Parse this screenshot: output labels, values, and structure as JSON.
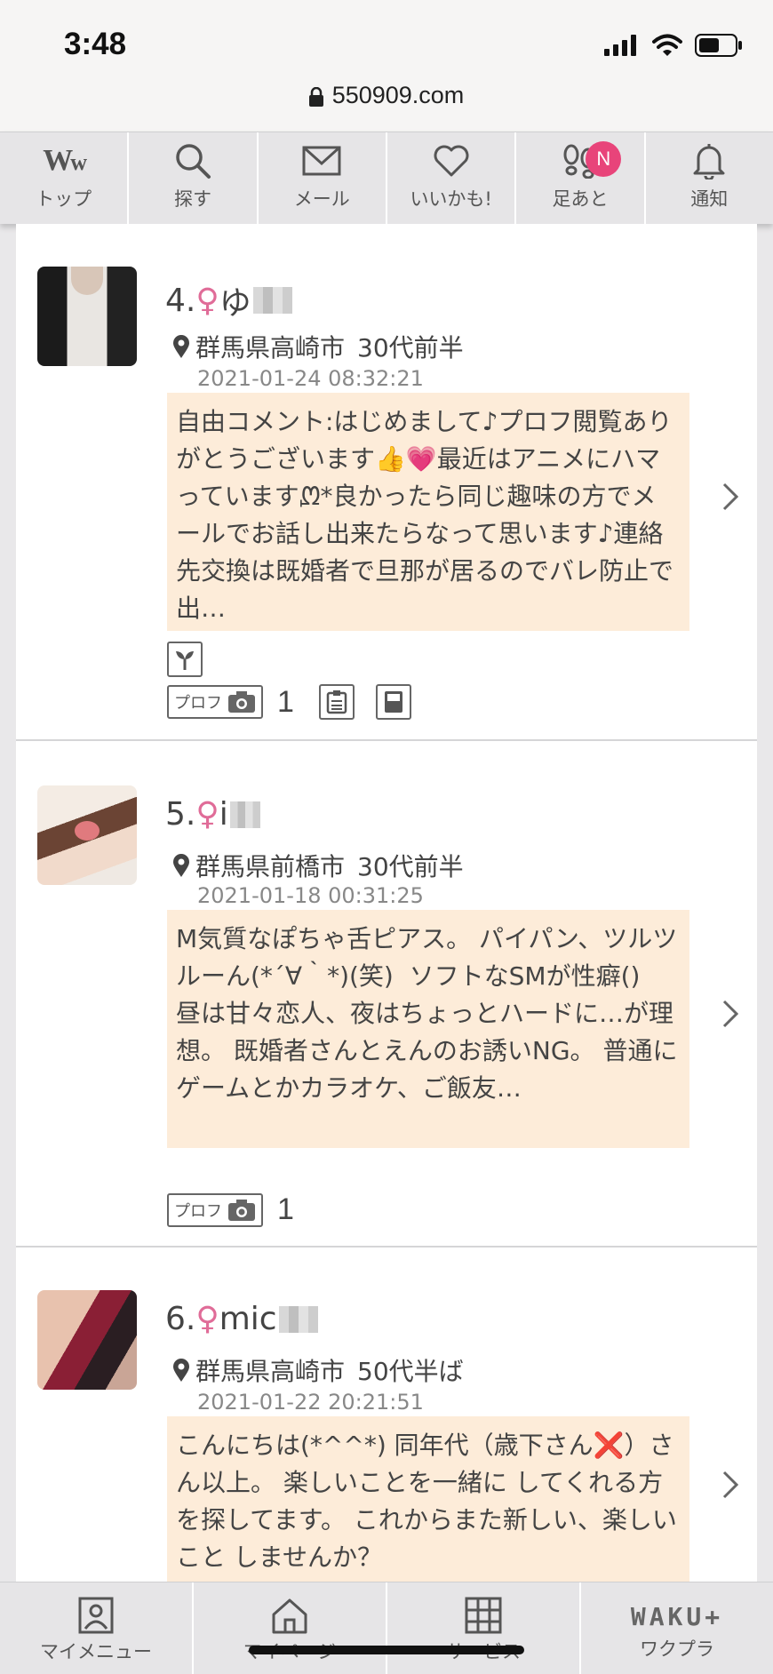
{
  "status_bar": {
    "time": "3:48",
    "url": "550909.com",
    "icons": [
      "cellular-signal-icon",
      "wifi-icon",
      "battery-icon",
      "lock-icon"
    ]
  },
  "top_nav": {
    "items": [
      {
        "label": "トップ",
        "icon": "ww-logo-icon"
      },
      {
        "label": "探す",
        "icon": "search-icon"
      },
      {
        "label": "メール",
        "icon": "mail-icon"
      },
      {
        "label": "いいかも!",
        "icon": "heart-icon"
      },
      {
        "label": "足あと",
        "icon": "footprints-icon",
        "badge": "N"
      },
      {
        "label": "通知",
        "icon": "bell-icon"
      }
    ],
    "badge_color": "#e8447a"
  },
  "profiles": [
    {
      "number": "4.",
      "gender_symbol": "♀",
      "name": "ゆ",
      "location": "群馬県高崎市",
      "age": "30代前半",
      "date": "2021-01-24 08:32:21",
      "comment": "自由コメント:はじめまして♪プロフ閲覧ありがとうございます👍💗最近はアニメにハマっています​ᘻ​*良かったら同じ趣味の方でメールでお話し出来たらなって思います♪連絡先交換は既婚者で旦那が居るのでバレ防止で出…",
      "prof_label": "プロフ",
      "photo_count": "1",
      "has_sprout_icon": true,
      "has_doc_icon": true,
      "has_book_icon": true
    },
    {
      "number": "5.",
      "gender_symbol": "♀",
      "name": "i",
      "location": "群馬県前橋市",
      "age": "30代前半",
      "date": "2021-01-18 00:31:25",
      "comment": "M気質なぽちゃ舌ピアス。 パイパン、ツルツルーん(*´∀｀*)(笑)  ソフトなSMが性癖()  昼は甘々恋人、夜はちょっとハードに…が理想。 既婚者さんとえんのお誘いNG。 普通にゲームとかカラオケ、ご飯友…",
      "prof_label": "プロフ",
      "photo_count": "1"
    },
    {
      "number": "6.",
      "gender_symbol": "♀",
      "name": "mic",
      "location": "群馬県高崎市",
      "age": "50代半ば",
      "date": "2021-01-22 20:21:51",
      "comment": "こんにちは(*^^*) 同年代（歳下さん❌）さん以上。 楽しいことを一緒に してくれる方を探してます。 これからまた新しい、楽しいこと しませんか？"
    }
  ],
  "bottom_nav": {
    "items": [
      {
        "label": "マイメニュー",
        "icon": "person-icon"
      },
      {
        "label": "マイページ",
        "icon": "home-icon"
      },
      {
        "label": "サービス",
        "icon": "grid-icon"
      },
      {
        "label": "ワクプラ",
        "logo": "WAKU+"
      }
    ]
  },
  "colors": {
    "comment_bg": "#fdecd9",
    "female_symbol": "#e06c98",
    "nav_bg": "#e6e5e7"
  }
}
